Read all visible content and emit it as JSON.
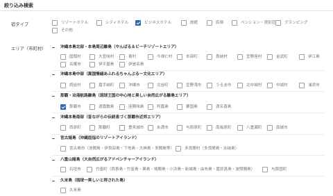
{
  "title": "絞り込み検索",
  "lodging": {
    "label": "宿タイプ",
    "options": [
      {
        "label": "リゾートホテル",
        "checked": false
      },
      {
        "label": "シティホテル",
        "checked": false
      },
      {
        "label": "ビジネスホテル",
        "checked": true
      },
      {
        "label": "旅館",
        "checked": false
      },
      {
        "label": "民宿",
        "checked": false
      },
      {
        "label": "ペンション・貸別荘",
        "checked": false
      },
      {
        "label": "グランピング",
        "checked": false
      },
      {
        "label": "その他",
        "checked": false
      }
    ]
  },
  "area": {
    "label": "エリア（市町村）",
    "groups": [
      {
        "title": "沖縄本島北部・本島周辺離島（やんばる＆ビーチリゾートエリア）",
        "rows": [
          [
            {
              "label": "国頭村",
              "checked": false
            },
            {
              "label": "大宜味村",
              "checked": false
            },
            {
              "label": "東村",
              "checked": false
            },
            {
              "label": "今帰仁村",
              "checked": false
            },
            {
              "label": "本部町",
              "checked": false
            },
            {
              "label": "恩納村",
              "checked": false
            },
            {
              "label": "宜野座村",
              "checked": false
            },
            {
              "label": "金武町",
              "checked": false
            },
            {
              "label": "伊江島",
              "checked": false
            }
          ],
          [
            {
              "label": "名護市",
              "checked": false
            },
            {
              "label": "伊平屋島",
              "checked": false
            },
            {
              "label": "伊是名島",
              "checked": false
            }
          ]
        ]
      },
      {
        "title": "沖縄本島中部（異国情緒あふれるちゃんぷるー文化エリア）",
        "rows": [
          [
            {
              "label": "読谷村",
              "checked": false
            },
            {
              "label": "嘉手納町",
              "checked": false
            },
            {
              "label": "沖縄市",
              "checked": false
            },
            {
              "label": "北谷町",
              "checked": false
            },
            {
              "label": "宜野湾市",
              "checked": false
            },
            {
              "label": "うるま市",
              "checked": false
            },
            {
              "label": "北中城村",
              "checked": false
            },
            {
              "label": "中城村",
              "checked": false
            },
            {
              "label": "浦添市",
              "checked": false
            }
          ]
        ]
      },
      {
        "title": "那覇・泊港航路離島（琉球王国の中心地と美しい自然広がる離島エリア）",
        "rows": [
          [
            {
              "label": "那覇市",
              "checked": true
            },
            {
              "label": "渡嘉敷島",
              "checked": false
            },
            {
              "label": "座間味島",
              "checked": false
            },
            {
              "label": "阿嘉島",
              "checked": false
            },
            {
              "label": "粟国島",
              "checked": false
            },
            {
              "label": "渡名喜島",
              "checked": false
            }
          ]
        ]
      },
      {
        "title": "沖縄本島南部（昔ながらの伝統息づく那覇市近郊エリア）",
        "rows": [
          [
            {
              "label": "西原町",
              "checked": false
            },
            {
              "label": "那覇町",
              "checked": false
            },
            {
              "label": "豊見城市",
              "checked": false
            },
            {
              "label": "糸満市",
              "checked": false
            },
            {
              "label": "与那原町",
              "checked": false
            },
            {
              "label": "南風原町",
              "checked": false
            },
            {
              "label": "八重瀬町",
              "checked": false
            },
            {
              "label": "南城市",
              "checked": false
            }
          ]
        ]
      },
      {
        "title": "宮古諸島（沖縄屈指のリゾートアイランド）",
        "rows": [
          [
            {
              "label": "宮古島市（池間島・伊良部島・下地島・大神島・来間島等）",
              "checked": false
            },
            {
              "label": "多良間村（多良間島・水納島）",
              "checked": false
            }
          ]
        ]
      },
      {
        "title": "八重山諸島（大自然広がるアドベンチャーアイランド）",
        "rows": [
          [
            {
              "label": "石垣市",
              "checked": false
            },
            {
              "label": "竹富町（西表島・竹富島・黒島・鳩間島・小浜島・新城島・由布島・嘉弥真島・波照間島）",
              "checked": false
            },
            {
              "label": "与那国町",
              "checked": false
            }
          ]
        ]
      },
      {
        "title": "久米島（琉球一美しいと称された島）",
        "rows": [
          [
            {
              "label": "久米島",
              "checked": false
            }
          ]
        ]
      }
    ]
  }
}
